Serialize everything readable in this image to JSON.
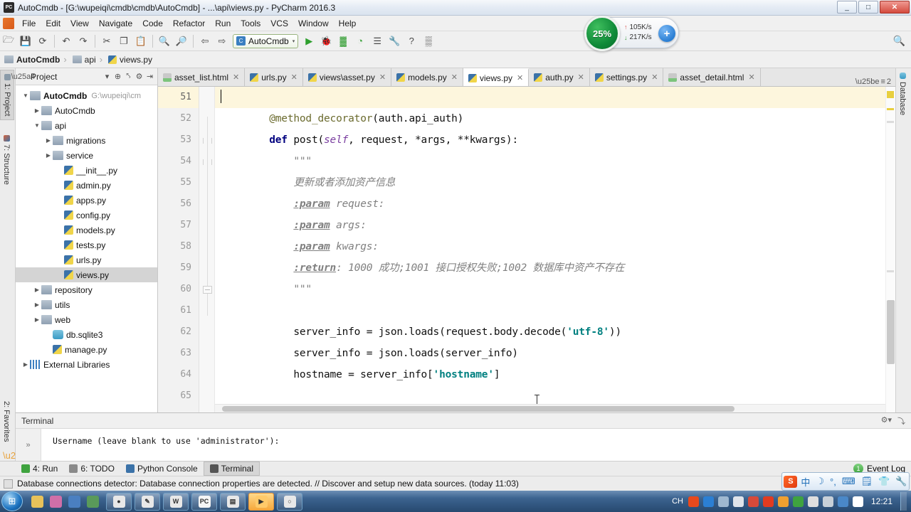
{
  "window": {
    "title": "AutoCmdb - [G:\\wupeiqi\\cmdb\\cmdb\\AutoCmdb] - ...\\api\\views.py - PyCharm 2016.3",
    "app_icon": "PC",
    "minimize": "_",
    "maximize": "□",
    "close": "✕"
  },
  "menubar": {
    "items": [
      {
        "label": "File"
      },
      {
        "label": "Edit"
      },
      {
        "label": "View"
      },
      {
        "label": "Navigate"
      },
      {
        "label": "Code"
      },
      {
        "label": "Refactor"
      },
      {
        "label": "Run"
      },
      {
        "label": "Tools"
      },
      {
        "label": "VCS"
      },
      {
        "label": "Window"
      },
      {
        "label": "Help"
      }
    ]
  },
  "toolbar": {
    "buttons": [
      {
        "name": "open-icon",
        "glyph": "🗁"
      },
      {
        "name": "save-all-icon",
        "glyph": "💾"
      },
      {
        "name": "sync-icon",
        "glyph": "⟳"
      },
      {
        "name": "undo-icon",
        "glyph": "↶"
      },
      {
        "name": "redo-icon",
        "glyph": "↷"
      },
      {
        "name": "cut-icon",
        "glyph": "✂"
      },
      {
        "name": "copy-icon",
        "glyph": "❐"
      },
      {
        "name": "paste-icon",
        "glyph": "📋"
      },
      {
        "name": "find-icon",
        "glyph": "🔍"
      },
      {
        "name": "replace-icon",
        "glyph": "🔎"
      },
      {
        "name": "back-icon",
        "glyph": "⇦"
      },
      {
        "name": "forward-icon",
        "glyph": "⇨"
      }
    ],
    "run_config": {
      "icon_text": "C",
      "label": "AutoCmdb",
      "arrow": "▾"
    },
    "right_buttons": [
      {
        "name": "run-icon",
        "glyph": "▶"
      },
      {
        "name": "debug-icon",
        "glyph": "🐞"
      },
      {
        "name": "coverage-icon",
        "glyph": "▓"
      },
      {
        "name": "profile-icon",
        "glyph": "◔"
      },
      {
        "name": "stop-icon",
        "glyph": "☰"
      },
      {
        "name": "settings-icon",
        "glyph": "🔧"
      },
      {
        "name": "help-icon",
        "glyph": "?"
      },
      {
        "name": "database-icon",
        "glyph": "▒"
      }
    ],
    "search_glyph": "🔍"
  },
  "network_widget": {
    "percent": "25%",
    "upload": "105K/s",
    "download": "217K/s",
    "up_arrow": "↑",
    "down_arrow": "↓",
    "plus": "+"
  },
  "breadcrumb": {
    "items": [
      {
        "label": "AutoCmdb",
        "icon": "folder"
      },
      {
        "label": "api",
        "icon": "folder"
      },
      {
        "label": "views.py",
        "icon": "pyfile"
      }
    ],
    "separator": "›"
  },
  "left_strip": {
    "items": [
      {
        "label": "1: Project",
        "selected": true
      },
      {
        "label": "7: Structure",
        "selected": false
      }
    ],
    "favorites_label": "2: Favorites"
  },
  "right_strip": {
    "items": [
      {
        "label": "Database"
      }
    ]
  },
  "project_panel": {
    "title": "Project",
    "header_icons": [
      {
        "name": "view-mode-icon",
        "glyph": "▾"
      },
      {
        "name": "target-icon",
        "glyph": "⊕"
      },
      {
        "name": "collapse-all-icon",
        "glyph": "⤣"
      },
      {
        "name": "gear-icon",
        "glyph": "⚙"
      },
      {
        "name": "hide-icon",
        "glyph": "⇥"
      }
    ],
    "tree": [
      {
        "label": "AutoCmdb",
        "path": "G:\\wupeiqi\\cm",
        "indent": 0,
        "arrow": "▼",
        "icon": "folder",
        "bold": true,
        "selected": false
      },
      {
        "label": "AutoCmdb",
        "path": "",
        "indent": 1,
        "arrow": "▶",
        "icon": "folder",
        "bold": false,
        "selected": false
      },
      {
        "label": "api",
        "path": "",
        "indent": 1,
        "arrow": "▼",
        "icon": "folder",
        "bold": false,
        "selected": false
      },
      {
        "label": "migrations",
        "path": "",
        "indent": 2,
        "arrow": "▶",
        "icon": "folder",
        "bold": false,
        "selected": false
      },
      {
        "label": "service",
        "path": "",
        "indent": 2,
        "arrow": "▶",
        "icon": "folder",
        "bold": false,
        "selected": false
      },
      {
        "label": "__init__.py",
        "path": "",
        "indent": 3,
        "arrow": "",
        "icon": "py",
        "bold": false,
        "selected": false
      },
      {
        "label": "admin.py",
        "path": "",
        "indent": 3,
        "arrow": "",
        "icon": "py",
        "bold": false,
        "selected": false
      },
      {
        "label": "apps.py",
        "path": "",
        "indent": 3,
        "arrow": "",
        "icon": "py",
        "bold": false,
        "selected": false
      },
      {
        "label": "config.py",
        "path": "",
        "indent": 3,
        "arrow": "",
        "icon": "py",
        "bold": false,
        "selected": false
      },
      {
        "label": "models.py",
        "path": "",
        "indent": 3,
        "arrow": "",
        "icon": "py",
        "bold": false,
        "selected": false
      },
      {
        "label": "tests.py",
        "path": "",
        "indent": 3,
        "arrow": "",
        "icon": "py",
        "bold": false,
        "selected": false
      },
      {
        "label": "urls.py",
        "path": "",
        "indent": 3,
        "arrow": "",
        "icon": "py",
        "bold": false,
        "selected": false
      },
      {
        "label": "views.py",
        "path": "",
        "indent": 3,
        "arrow": "",
        "icon": "py",
        "bold": false,
        "selected": true
      },
      {
        "label": "repository",
        "path": "",
        "indent": 1,
        "arrow": "▶",
        "icon": "folder",
        "bold": false,
        "selected": false
      },
      {
        "label": "utils",
        "path": "",
        "indent": 1,
        "arrow": "▶",
        "icon": "folder",
        "bold": false,
        "selected": false
      },
      {
        "label": "web",
        "path": "",
        "indent": 1,
        "arrow": "▶",
        "icon": "folder",
        "bold": false,
        "selected": false
      },
      {
        "label": "db.sqlite3",
        "path": "",
        "indent": 2,
        "arrow": "",
        "icon": "db",
        "bold": false,
        "selected": false
      },
      {
        "label": "manage.py",
        "path": "",
        "indent": 2,
        "arrow": "",
        "icon": "py",
        "bold": false,
        "selected": false
      },
      {
        "label": "External Libraries",
        "path": "",
        "indent": 0,
        "arrow": "▶",
        "icon": "lib",
        "bold": false,
        "selected": false
      }
    ]
  },
  "editor_tabs": {
    "tabs": [
      {
        "label": "asset_list.html",
        "icon": "html",
        "active": false,
        "close": "✕"
      },
      {
        "label": "urls.py",
        "icon": "py",
        "active": false,
        "close": "✕"
      },
      {
        "label": "views\\asset.py",
        "icon": "py",
        "active": false,
        "close": "✕"
      },
      {
        "label": "models.py",
        "icon": "py",
        "active": false,
        "close": "✕"
      },
      {
        "label": "views.py",
        "icon": "py",
        "active": true,
        "close": "✕"
      },
      {
        "label": "auth.py",
        "icon": "py",
        "active": false,
        "close": "✕"
      },
      {
        "label": "settings.py",
        "icon": "py",
        "active": false,
        "close": "✕"
      },
      {
        "label": "asset_detail.html",
        "icon": "html",
        "active": false,
        "close": "✕"
      }
    ],
    "overflow_label": "2",
    "overflow_glyph": "≡"
  },
  "editor": {
    "lines": [
      {
        "num": "51",
        "current": true,
        "html": "<span class=\"caret\"></span>"
      },
      {
        "num": "52",
        "current": false,
        "html": "        <span class=\"dec\">@method_decorator</span>(auth.api_auth)"
      },
      {
        "num": "53",
        "current": false,
        "html": "        <span class=\"kw\">def</span> post(<span class=\"builtin\">self</span>, request, *args, **kwargs):"
      },
      {
        "num": "54",
        "current": false,
        "html": "            <span class=\"doc\">&quot;&quot;&quot;</span>"
      },
      {
        "num": "55",
        "current": false,
        "html": "            <span class=\"doc\">更新或者添加资产信息</span>"
      },
      {
        "num": "56",
        "current": false,
        "html": "            <span class=\"doctag\">:param</span> <span class=\"doc\">request:</span>"
      },
      {
        "num": "57",
        "current": false,
        "html": "            <span class=\"doctag\">:param</span> <span class=\"doc\">args:</span>"
      },
      {
        "num": "58",
        "current": false,
        "html": "            <span class=\"doctag\">:param</span> <span class=\"doc\">kwargs:</span>"
      },
      {
        "num": "59",
        "current": false,
        "html": "            <span class=\"doctag\">:return</span><span class=\"doc\">: 1000 成功;1001 接口授权失败;1002 数据库中资产不存在</span>"
      },
      {
        "num": "60",
        "current": false,
        "html": "            <span class=\"doc\">&quot;&quot;&quot;</span>"
      },
      {
        "num": "61",
        "current": false,
        "html": ""
      },
      {
        "num": "62",
        "current": false,
        "html": "            server_info = json.loads(request.body.decode(<span class=\"str\">'utf-8'</span>))"
      },
      {
        "num": "63",
        "current": false,
        "html": "            server_info = json.loads(server_info)"
      },
      {
        "num": "64",
        "current": false,
        "html": "            hostname = server_info[<span class=\"str\">'hostname'</span>]"
      },
      {
        "num": "65",
        "current": false,
        "html": ""
      }
    ]
  },
  "terminal": {
    "title": "Terminal",
    "prompt_glyph": "»",
    "output": "Username (leave blank to use 'administrator'):",
    "tool_icons": [
      {
        "name": "terminal-settings-icon",
        "glyph": "⚙▾"
      },
      {
        "name": "terminal-hide-icon",
        "glyph": "⤵"
      }
    ]
  },
  "bottom_tabs": {
    "tabs": [
      {
        "label": "4: Run",
        "icon_color": "#3fa33f",
        "selected": false
      },
      {
        "label": "6: TODO",
        "icon_color": "#8a8a8a",
        "selected": false
      },
      {
        "label": "Python Console",
        "icon_color": "#3b72a8",
        "selected": false
      },
      {
        "label": "Terminal",
        "icon_color": "#555555",
        "selected": true
      }
    ],
    "event_log": {
      "label": "Event Log",
      "badge": "1"
    }
  },
  "statusbar": {
    "message": "Database connections detector: Database connection properties are detected. // Discover and setup new data sources. (today 11:03)"
  },
  "ime_bar": {
    "logo": "S",
    "items": [
      {
        "name": "ime-language-icon",
        "glyph": "中"
      },
      {
        "name": "ime-moon-icon",
        "glyph": "☽"
      },
      {
        "name": "ime-punctuation-icon",
        "glyph": "°,"
      },
      {
        "name": "ime-keyboard-icon",
        "glyph": "⌨"
      },
      {
        "name": "ime-toolbox-icon",
        "glyph": "🗒"
      },
      {
        "name": "ime-skin-icon",
        "glyph": "👕"
      },
      {
        "name": "ime-settings-icon",
        "glyph": "🔧"
      }
    ]
  },
  "taskbar": {
    "start_glyph": "⊞",
    "quick_launch": [
      {
        "name": "quicklaunch-palette-icon",
        "color": "#e8c25a"
      },
      {
        "name": "quicklaunch-paint-icon",
        "color": "#d06fa8"
      },
      {
        "name": "quicklaunch-save-icon",
        "color": "#4a7fc1"
      },
      {
        "name": "quicklaunch-key-icon",
        "color": "#5a9a5a"
      }
    ],
    "windows": [
      {
        "name": "taskbar-chrome",
        "glyph": "●",
        "color": "#e8e8e8",
        "active": false
      },
      {
        "name": "taskbar-editor",
        "glyph": "✎",
        "color": "#e8e8e8",
        "active": false
      },
      {
        "name": "taskbar-word",
        "glyph": "W",
        "color": "#e8e8e8",
        "active": false
      },
      {
        "name": "taskbar-pycharm",
        "glyph": "PC",
        "color": "#f5f5f5",
        "active": false
      },
      {
        "name": "taskbar-explorer",
        "glyph": "▤",
        "color": "#e8e8e8",
        "active": false
      },
      {
        "name": "taskbar-media",
        "glyph": "▶",
        "color": "#ffca6a",
        "active": true
      },
      {
        "name": "taskbar-other",
        "glyph": "○",
        "color": "#e8e8e8",
        "active": false
      }
    ],
    "tray": {
      "lang": "CH",
      "icons": [
        {
          "name": "tray-sogou-icon",
          "color": "#e8491c"
        },
        {
          "name": "tray-help-icon",
          "color": "#2b7fd4"
        },
        {
          "name": "tray-window-icon",
          "color": "#9fb8d0"
        },
        {
          "name": "tray-cloud-icon",
          "color": "#e0e4ea"
        },
        {
          "name": "tray-pin-icon",
          "color": "#d84a3a"
        },
        {
          "name": "tray-record-icon",
          "color": "#e23b20"
        },
        {
          "name": "tray-qq-icon",
          "color": "#f0a030"
        },
        {
          "name": "tray-safe-icon",
          "color": "#3fa33f"
        },
        {
          "name": "tray-copy-icon",
          "color": "#dedede"
        },
        {
          "name": "tray-network-icon",
          "color": "#c8d0d8"
        },
        {
          "name": "tray-monitor-icon",
          "color": "#4a88c8"
        },
        {
          "name": "tray-volume-icon",
          "color": "#ffffff"
        }
      ],
      "clock": "12:21"
    }
  }
}
